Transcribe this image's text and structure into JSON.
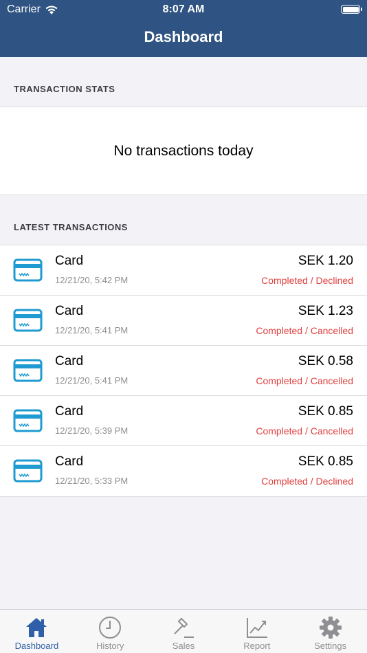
{
  "status_bar": {
    "carrier": "Carrier",
    "time": "8:07 AM"
  },
  "nav": {
    "title": "Dashboard"
  },
  "stats": {
    "header": "TRANSACTION STATS",
    "empty_message": "No transactions today"
  },
  "latest": {
    "header": "LATEST TRANSACTIONS",
    "items": [
      {
        "type": "Card",
        "datetime": "12/21/20, 5:42 PM",
        "amount": "SEK 1.20",
        "status": "Completed / Declined"
      },
      {
        "type": "Card",
        "datetime": "12/21/20, 5:41 PM",
        "amount": "SEK 1.23",
        "status": "Completed / Cancelled"
      },
      {
        "type": "Card",
        "datetime": "12/21/20, 5:41 PM",
        "amount": "SEK 0.58",
        "status": "Completed / Cancelled"
      },
      {
        "type": "Card",
        "datetime": "12/21/20, 5:39 PM",
        "amount": "SEK 0.85",
        "status": "Completed / Cancelled"
      },
      {
        "type": "Card",
        "datetime": "12/21/20, 5:33 PM",
        "amount": "SEK 0.85",
        "status": "Completed / Declined"
      }
    ]
  },
  "tabs": [
    {
      "label": "Dashboard",
      "icon": "home-icon",
      "active": true
    },
    {
      "label": "History",
      "icon": "clock-icon",
      "active": false
    },
    {
      "label": "Sales",
      "icon": "gavel-icon",
      "active": false
    },
    {
      "label": "Report",
      "icon": "chart-icon",
      "active": false
    },
    {
      "label": "Settings",
      "icon": "gear-icon",
      "active": false
    }
  ],
  "colors": {
    "header_bg": "#2f5382",
    "accent": "#2f5fa8",
    "card_icon": "#1f9bd1",
    "status_red": "#e0403f"
  }
}
